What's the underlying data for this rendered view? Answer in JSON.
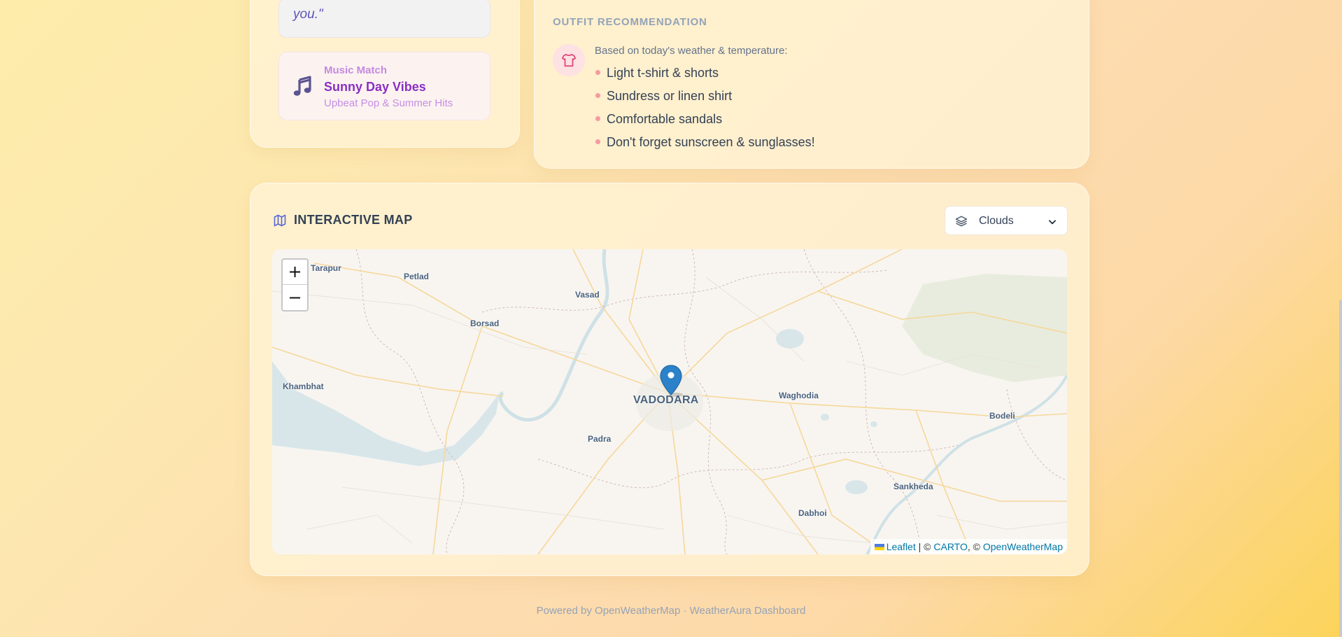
{
  "quote": {
    "text": "you.\""
  },
  "music": {
    "icon": "music-note-icon",
    "label": "Music Match",
    "title": "Sunny Day Vibes",
    "subtitle": "Upbeat Pop & Summer Hits"
  },
  "outfit": {
    "heading": "OUTFIT RECOMMENDATION",
    "icon": "shirt-icon",
    "intro": "Based on today's weather & temperature:",
    "items": [
      "Light t-shirt & shorts",
      "Sundress or linen shirt",
      "Comfortable sandals",
      "Don't forget sunscreen & sunglasses!"
    ]
  },
  "map": {
    "icon": "map-icon",
    "title": "INTERACTIVE MAP",
    "layer_select": {
      "icon": "layers-icon",
      "selected": "Clouds"
    },
    "zoom_in": "+",
    "zoom_out": "−",
    "cities": {
      "tarapur": "Tarapur",
      "petlad": "Petlad",
      "vasad": "Vasad",
      "borsad": "Borsad",
      "khambhat": "Khambhat",
      "vadodara": "VADODARA",
      "waghodia": "Waghodia",
      "bodeli": "Bodeli",
      "padra": "Padra",
      "sankheda": "Sankheda",
      "dabhoi": "Dabhoi"
    },
    "marker_icon": "location-pin-icon",
    "attribution": {
      "leaflet": "Leaflet",
      "sep1": " | © ",
      "carto": "CARTO",
      "sep2": ", © ",
      "owm": "OpenWeatherMap"
    }
  },
  "footer": {
    "text": "Powered by OpenWeatherMap · WeatherAura Dashboard"
  },
  "colors": {
    "accent_purple": "#8a2fc2",
    "map_link": "#0078a8",
    "marker_blue": "#2c82c9"
  }
}
